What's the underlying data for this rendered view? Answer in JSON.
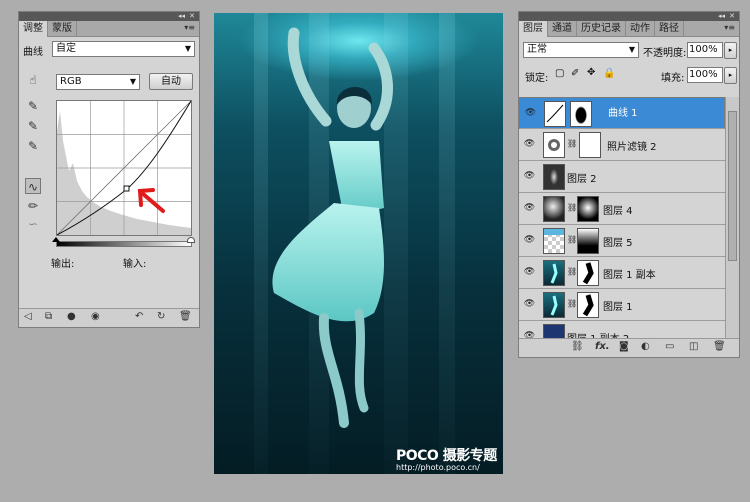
{
  "adjustments": {
    "tabs": [
      {
        "label": "调整"
      },
      {
        "label": "蒙版"
      }
    ],
    "preset_label": "曲线",
    "preset_value": "自定",
    "channel": "RGB",
    "auto_button": "自动",
    "output_label": "输出:",
    "input_label": "输入:"
  },
  "photo": {
    "watermark_brand": "POCO 摄影专题",
    "watermark_url": "http://photo.poco.cn/"
  },
  "layers": {
    "tabs": [
      {
        "label": "图层"
      },
      {
        "label": "通道"
      },
      {
        "label": "历史记录"
      },
      {
        "label": "动作"
      },
      {
        "label": "路径"
      }
    ],
    "blend_mode": "正常",
    "opacity_label": "不透明度:",
    "opacity_value": "100%",
    "lock_label": "锁定:",
    "fill_label": "填充:",
    "fill_value": "100%",
    "items": [
      {
        "name": "曲线 1"
      },
      {
        "name": "照片滤镜 2"
      },
      {
        "name": "图层 2"
      },
      {
        "name": "图层 4"
      },
      {
        "name": "图层 5"
      },
      {
        "name": "图层 1 副本"
      },
      {
        "name": "图层 1"
      },
      {
        "name": "图层 1 副本 2"
      }
    ],
    "footer_fx": "fx."
  },
  "colors": {
    "selected_layer": "#3a8ad6",
    "annotation_arrow": "#e11a1a",
    "panel_bg": "#d4d4d4"
  }
}
